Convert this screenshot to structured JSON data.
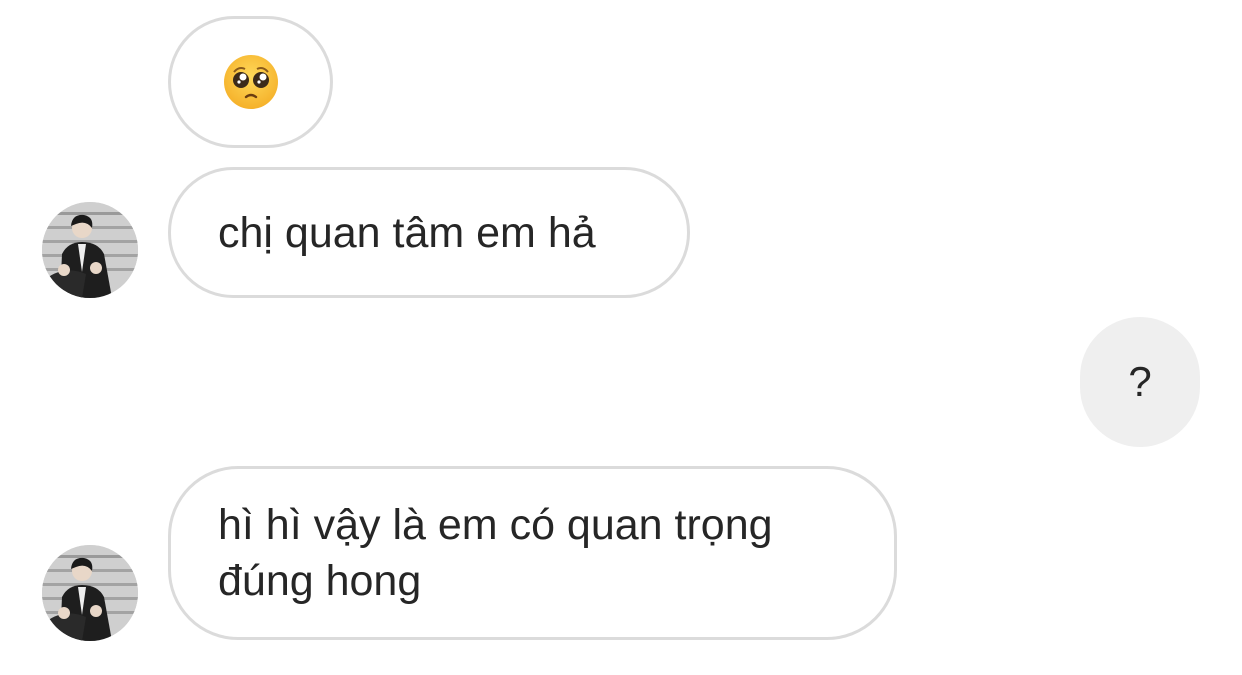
{
  "messages": [
    {
      "sender": "other",
      "kind": "emoji",
      "icon": "pleading-face-emoji"
    },
    {
      "sender": "other",
      "text": "chị quan tâm em hả"
    },
    {
      "sender": "me",
      "text": "?"
    },
    {
      "sender": "other",
      "text": "hì hì vậy là em có quan trọng đúng hong"
    }
  ],
  "colors": {
    "received_border": "#dbdbdb",
    "sent_background": "#efefef",
    "text": "#262626"
  }
}
